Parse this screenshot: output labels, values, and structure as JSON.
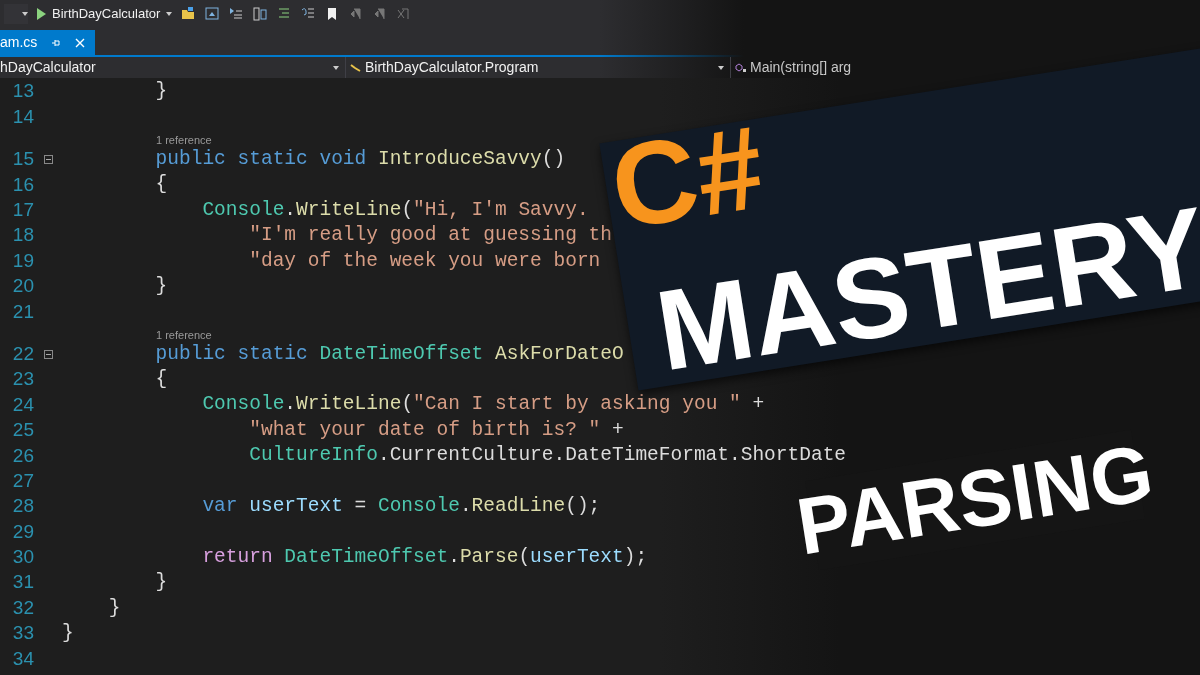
{
  "toolbar": {
    "project": "BirthDayCalculator"
  },
  "tab": {
    "label": "am.cs",
    "selected": true
  },
  "navbar": {
    "project": "hDayCalculator",
    "class": "BirthDayCalculator.Program",
    "member": "Main(string[] arg"
  },
  "code_lines": [
    {
      "kind": "code",
      "number": "13",
      "fold": false,
      "tokens": [
        {
          "t": "        }",
          "kind": "plain"
        }
      ]
    },
    {
      "kind": "code",
      "number": "14",
      "fold": false
    },
    {
      "kind": "lens",
      "text": "1 reference"
    },
    {
      "kind": "code",
      "number": "15",
      "fold": true,
      "tokens": [
        {
          "t": "        public static void",
          "kind": "keyword"
        },
        {
          "t": " IntroduceSavvy",
          "kind": "method"
        },
        {
          "t": "()",
          "kind": "plain"
        }
      ]
    },
    {
      "kind": "code",
      "number": "16",
      "fold": false,
      "tokens": [
        {
          "t": "        {",
          "kind": "plain"
        }
      ]
    },
    {
      "kind": "code",
      "number": "17",
      "fold": false,
      "tokens": [
        {
          "t": "            Console",
          "kind": "type"
        },
        {
          "t": ".",
          "kind": "plain"
        },
        {
          "t": "WriteLine",
          "kind": "method"
        },
        {
          "t": "(",
          "kind": "plain"
        },
        {
          "t": "\"Hi, I'm Savvy.",
          "kind": "string"
        }
      ]
    },
    {
      "kind": "code",
      "number": "18",
      "fold": false,
      "tokens": [
        {
          "t": "                \"I'm really good at guessing th",
          "kind": "string"
        }
      ]
    },
    {
      "kind": "code",
      "number": "19",
      "fold": false,
      "tokens": [
        {
          "t": "                \"day of the week you were born",
          "kind": "string"
        }
      ]
    },
    {
      "kind": "code",
      "number": "20",
      "fold": false,
      "tokens": [
        {
          "t": "        }",
          "kind": "plain"
        }
      ]
    },
    {
      "kind": "code",
      "number": "21",
      "fold": false
    },
    {
      "kind": "lens",
      "text": "1 reference"
    },
    {
      "kind": "code",
      "number": "22",
      "fold": true,
      "tokens": [
        {
          "t": "        public static",
          "kind": "keyword"
        },
        {
          "t": " DateTimeOffset",
          "kind": "type"
        },
        {
          "t": " AskForDateO",
          "kind": "method"
        }
      ]
    },
    {
      "kind": "code",
      "number": "23",
      "fold": false,
      "tokens": [
        {
          "t": "        {",
          "kind": "plain"
        }
      ]
    },
    {
      "kind": "code",
      "number": "24",
      "fold": false,
      "tokens": [
        {
          "t": "            Console",
          "kind": "type"
        },
        {
          "t": ".",
          "kind": "plain"
        },
        {
          "t": "WriteLine",
          "kind": "method"
        },
        {
          "t": "(",
          "kind": "plain"
        },
        {
          "t": "\"Can I start by asking you \"",
          "kind": "string"
        },
        {
          "t": " +",
          "kind": "plain"
        }
      ]
    },
    {
      "kind": "code",
      "number": "25",
      "fold": false,
      "tokens": [
        {
          "t": "                \"what your date of birth is? \"",
          "kind": "string"
        },
        {
          "t": " +",
          "kind": "plain"
        }
      ]
    },
    {
      "kind": "code",
      "number": "26",
      "fold": false,
      "tokens": [
        {
          "t": "                CultureInfo",
          "kind": "type"
        },
        {
          "t": ".CurrentCulture.DateTimeFormat.ShortDate",
          "kind": "plain"
        }
      ]
    },
    {
      "kind": "code",
      "number": "27",
      "fold": false
    },
    {
      "kind": "code",
      "number": "28",
      "fold": false,
      "tokens": [
        {
          "t": "            var",
          "kind": "keyword"
        },
        {
          "t": " userText",
          "kind": "variable"
        },
        {
          "t": " = ",
          "kind": "plain"
        },
        {
          "t": "Console",
          "kind": "type"
        },
        {
          "t": ".",
          "kind": "plain"
        },
        {
          "t": "ReadLine",
          "kind": "method"
        },
        {
          "t": "();",
          "kind": "plain"
        }
      ]
    },
    {
      "kind": "code",
      "number": "29",
      "fold": false
    },
    {
      "kind": "code",
      "number": "30",
      "fold": false,
      "tokens": [
        {
          "t": "            return",
          "kind": "control"
        },
        {
          "t": " DateTimeOffset",
          "kind": "type"
        },
        {
          "t": ".",
          "kind": "plain"
        },
        {
          "t": "Parse",
          "kind": "method"
        },
        {
          "t": "(",
          "kind": "plain"
        },
        {
          "t": "userText",
          "kind": "variable"
        },
        {
          "t": ");",
          "kind": "plain"
        }
      ]
    },
    {
      "kind": "code",
      "number": "31",
      "fold": false,
      "tokens": [
        {
          "t": "        }",
          "kind": "plain"
        }
      ]
    },
    {
      "kind": "code",
      "number": "32",
      "fold": false,
      "tokens": [
        {
          "t": "    }",
          "kind": "plain"
        }
      ]
    },
    {
      "kind": "code",
      "number": "33",
      "fold": false,
      "tokens": [
        {
          "t": "}",
          "kind": "plain"
        }
      ]
    },
    {
      "kind": "code",
      "number": "34",
      "fold": false
    }
  ],
  "overlay": {
    "language": "C#",
    "title": "MASTERY",
    "subtitle": "PARSING"
  }
}
